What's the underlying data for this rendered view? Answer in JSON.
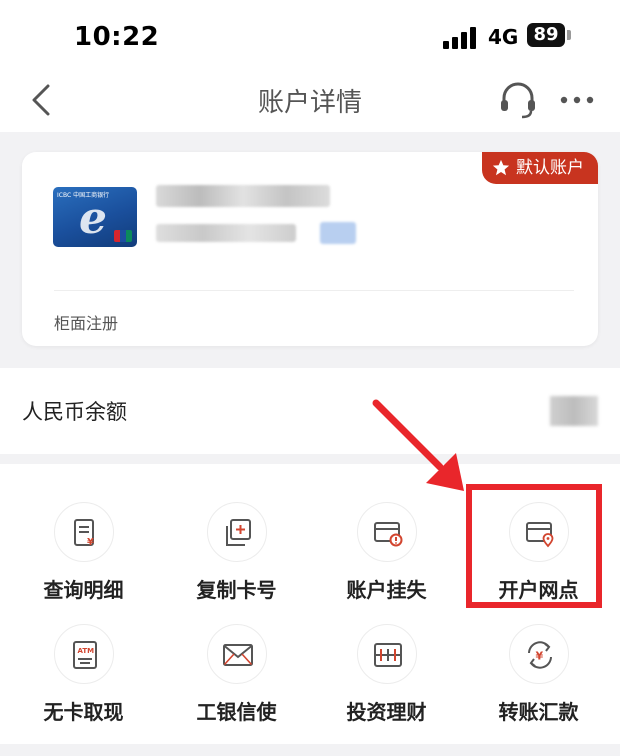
{
  "status_bar": {
    "time": "10:22",
    "network": "4G",
    "battery": "89"
  },
  "nav": {
    "title": "账户详情",
    "icons": [
      "back-icon",
      "headset-icon",
      "more-icon"
    ]
  },
  "card": {
    "badge": "默认账户",
    "register_type": "柜面注册",
    "card_brand": "ICBC 中国工商银行"
  },
  "balance": {
    "label": "人民币余额"
  },
  "menu": [
    {
      "label": "查询明细",
      "icon": "transaction-detail-icon"
    },
    {
      "label": "复制卡号",
      "icon": "copy-card-icon"
    },
    {
      "label": "账户挂失",
      "icon": "report-loss-icon"
    },
    {
      "label": "开户网点",
      "icon": "branch-location-icon"
    },
    {
      "label": "无卡取现",
      "icon": "atm-icon"
    },
    {
      "label": "工银信使",
      "icon": "messenger-icon"
    },
    {
      "label": "投资理财",
      "icon": "investment-icon"
    },
    {
      "label": "转账汇款",
      "icon": "transfer-icon"
    }
  ],
  "colors": {
    "accent": "#c8341f",
    "highlight": "#e9262b",
    "icon_stroke": "#555555",
    "icon_accent": "#d2452f"
  }
}
